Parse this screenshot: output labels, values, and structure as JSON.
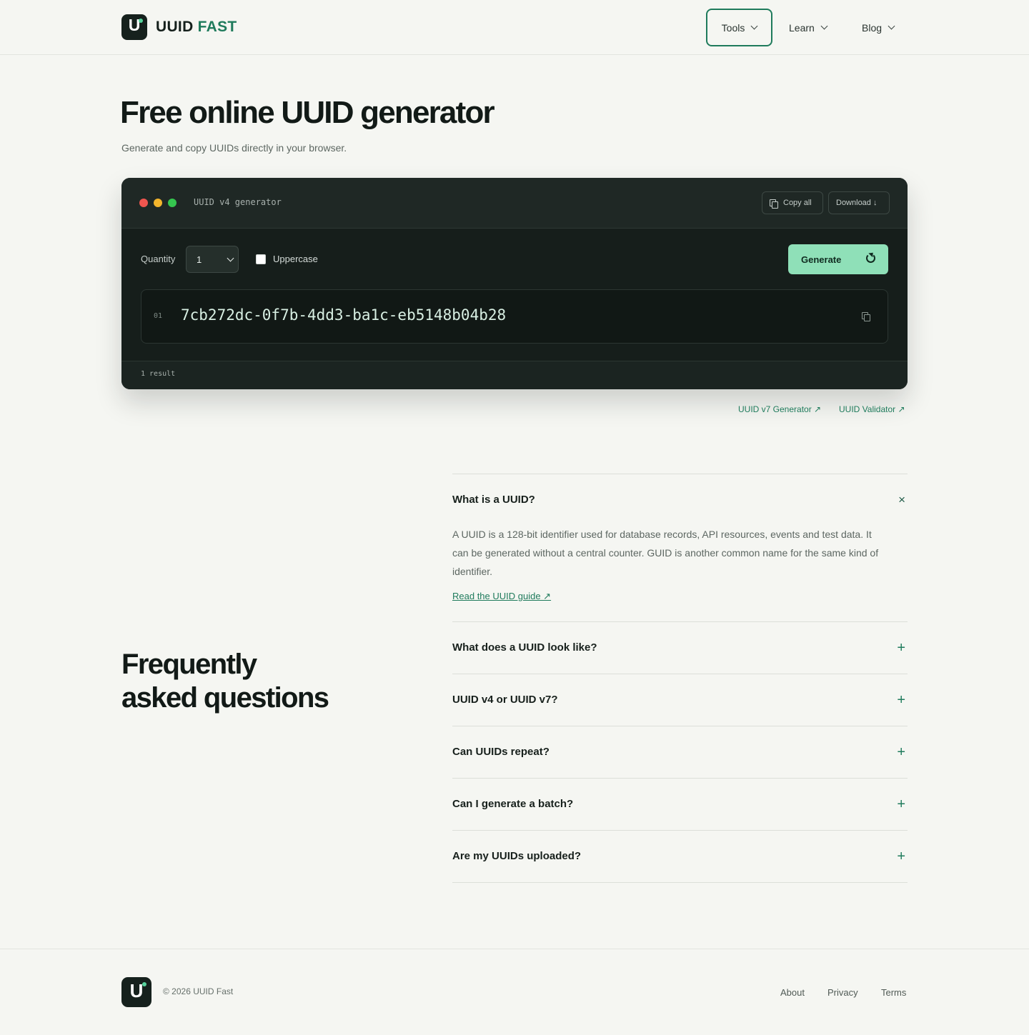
{
  "header": {
    "logo_mark": "U",
    "logo_text_1": "UUID",
    "logo_text_2": "FAST",
    "nav": [
      {
        "label": "Tools"
      },
      {
        "label": "Learn"
      },
      {
        "label": "Blog"
      }
    ]
  },
  "hero": {
    "title": "Free online UUID generator",
    "subtitle": "Generate and copy UUIDs directly in your browser."
  },
  "generator": {
    "title": "UUID v4 generator",
    "copy_all": "Copy all",
    "download": "Download ↓",
    "quantity_label": "Quantity",
    "quantity_value": "1",
    "uppercase_label": "Uppercase",
    "uppercase_checked": false,
    "generate": "Generate",
    "results": [
      {
        "num": "01",
        "uuid": "7cb272dc-0f7b-4dd3-ba1c-eb5148b04b28"
      }
    ],
    "count": "1 result"
  },
  "related_links": {
    "v7": "UUID v7 Generator ↗",
    "validator": "UUID Validator ↗"
  },
  "faq": {
    "title_line1": "Frequently",
    "title_line2": "asked questions",
    "items": [
      {
        "question": "What is a UUID?",
        "open": true,
        "answer": "A UUID is a 128-bit identifier used for database records, API resources, events and test data. It can be generated without a central counter. GUID is another common name for the same kind of identifier.",
        "link": "Read the UUID guide ↗"
      },
      {
        "question": "What does a UUID look like?",
        "open": false
      },
      {
        "question": "UUID v4 or UUID v7?",
        "open": false
      },
      {
        "question": "Can UUIDs repeat?",
        "open": false
      },
      {
        "question": "Can I generate a batch?",
        "open": false
      },
      {
        "question": "Are my UUIDs uploaded?",
        "open": false
      }
    ],
    "icon_open": "×",
    "icon_closed": "+"
  },
  "footer": {
    "copyright": "© 2026 UUID Fast",
    "links": [
      "About",
      "Privacy",
      "Terms"
    ]
  },
  "colors": {
    "accent": "#1f7b5c",
    "generate_button": "#8fe0b8",
    "panel_bg": "#161e1b",
    "page_bg": "#f5f6f2"
  }
}
